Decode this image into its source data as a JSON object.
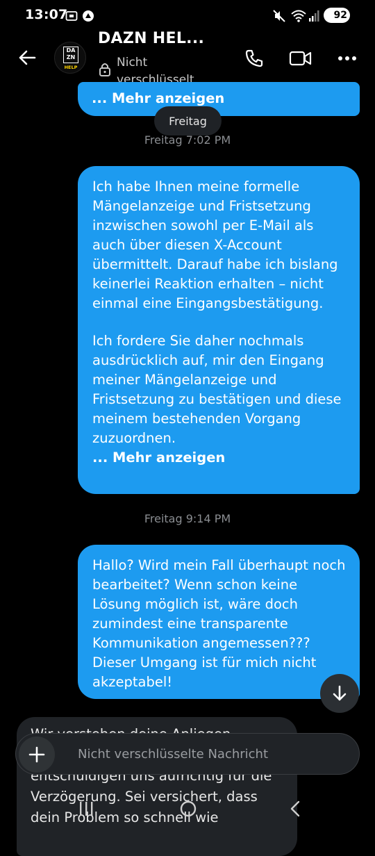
{
  "status_bar": {
    "time": "13:07",
    "battery": "92"
  },
  "header": {
    "title": "DAZN HEL...",
    "subtitle": "Nicht verschlüsselt",
    "avatar_logo_top": "DA",
    "avatar_logo_bottom": "ZN",
    "avatar_logo_tag": "HELP"
  },
  "day_pill": "Freitag",
  "messages": [
    {
      "more": "... Mehr anzeigen"
    },
    {
      "timestamp": "Freitag 7:02 PM",
      "paragraph1": "Ich habe Ihnen meine formelle Mängelanzeige und Fristsetzung inzwischen sowohl per E-Mail als auch über diesen X-Account übermittelt. Darauf habe ich bislang keinerlei Reaktion erhalten – nicht einmal eine Eingangsbestätigung.",
      "paragraph2": "Ich fordere Sie daher nochmals ausdrücklich auf, mir den Eingang meiner Mängelanzeige und Fristsetzung zu bestätigen und diese meinem bestehenden Vorgang zuzuordnen.",
      "more": "... Mehr anzeigen"
    },
    {
      "timestamp": "Freitag 9:14 PM",
      "text": "Hallo? Wird mein Fall überhaupt noch bearbeitet? Wenn schon keine Lösung möglich ist, wäre doch zumindest eine transparente Kommunikation angemessen??? Dieser Umgang ist für mich nicht akzeptabel!"
    },
    {
      "text": "Wir verstehen deine Anliegen ... derzeit an dem Problem, und wir entschuldigen uns aufrichtig für die Verzögerung. Sei versichert, dass dein Problem so schnell wie"
    }
  ],
  "composer": {
    "placeholder": "Nicht verschlüsselte Nachricht"
  },
  "colors": {
    "bubble_outgoing": "#1d9bf0",
    "bubble_incoming": "#202327",
    "background": "#000000"
  },
  "icons": [
    "back-arrow-icon",
    "lock-icon",
    "phone-icon",
    "video-icon",
    "more-icon",
    "scroll-down-icon",
    "plus-icon",
    "nav-recents-icon",
    "nav-home-icon",
    "nav-back-icon"
  ]
}
